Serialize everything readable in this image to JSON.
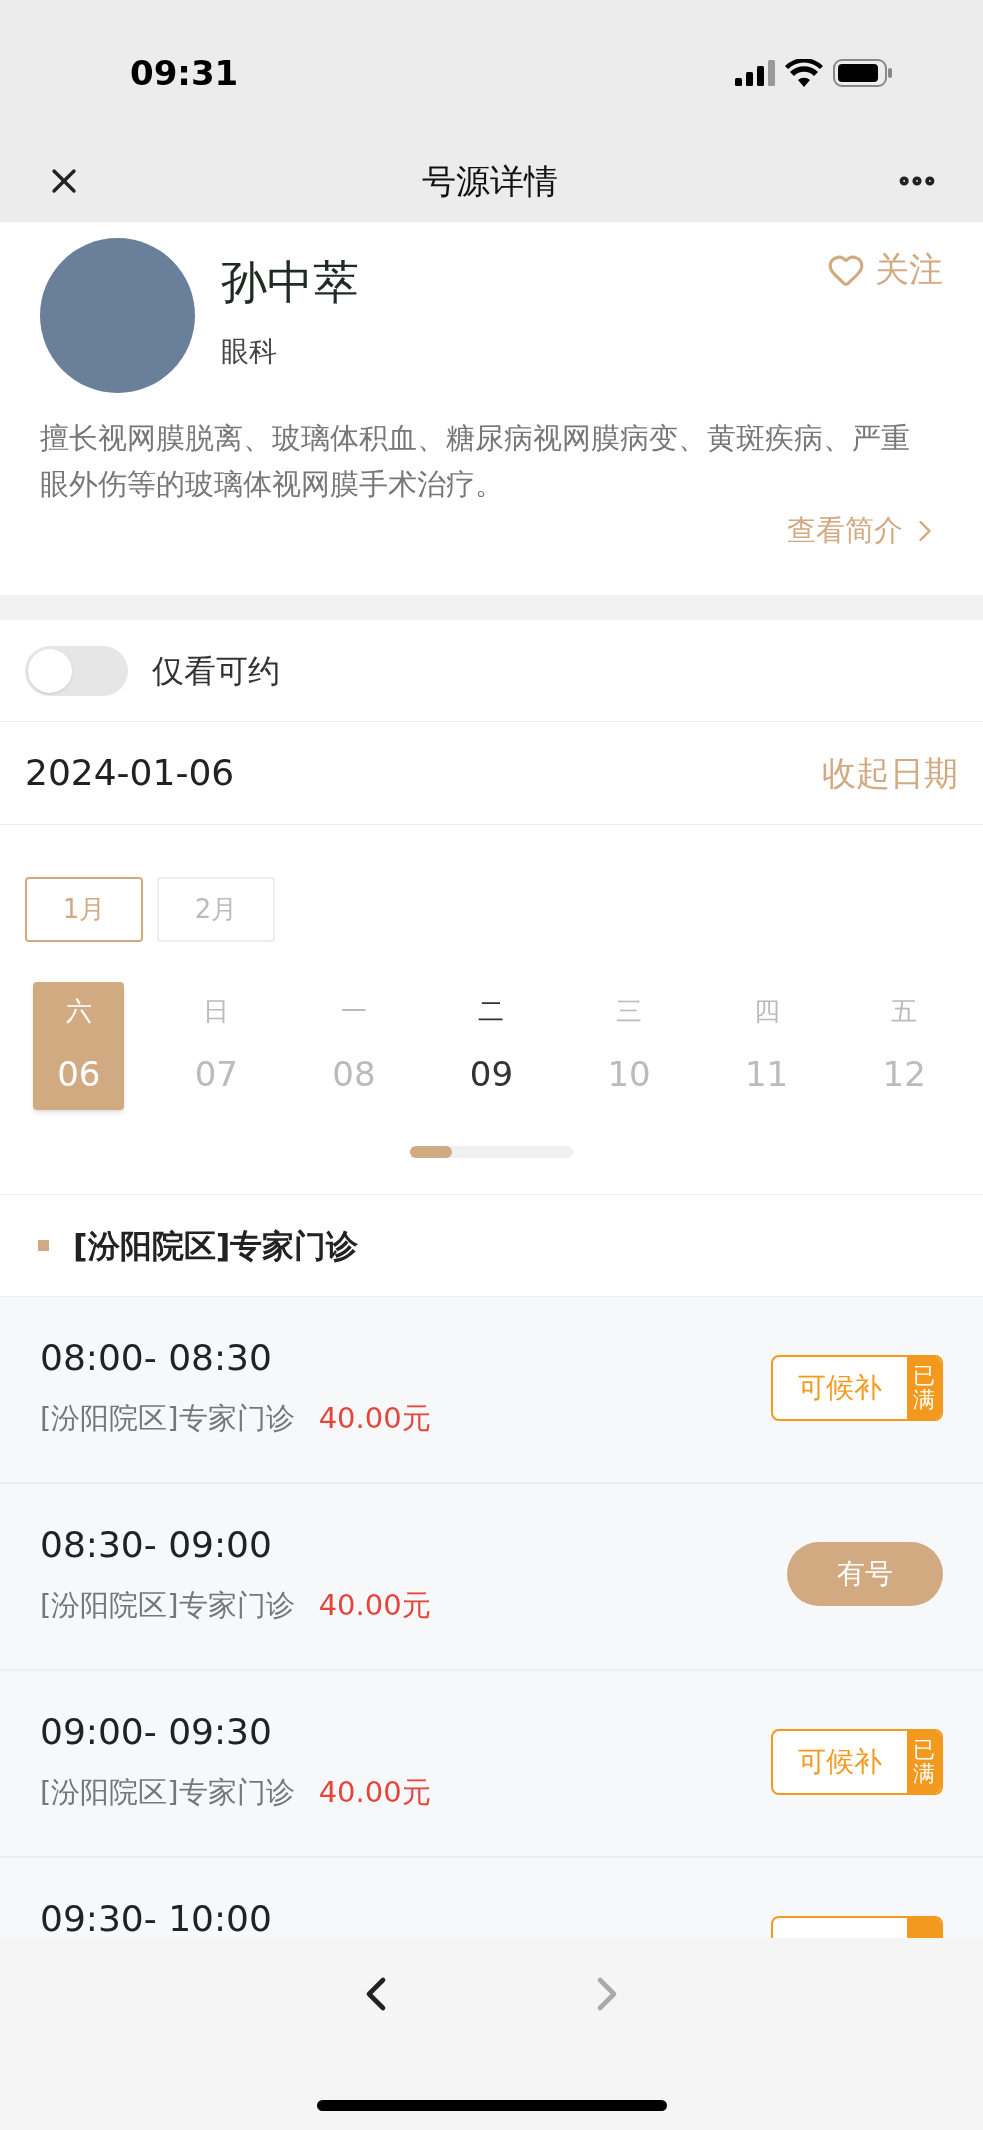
{
  "status_bar": {
    "time": "09:31"
  },
  "header": {
    "title": "号源详情"
  },
  "doctor": {
    "name": "孙中萃",
    "department": "眼科",
    "follow_label": "关注",
    "followed": false,
    "description": "擅长视网膜脱离、玻璃体积血、糖尿病视网膜病变、黄斑疾病、严重眼外伤等的玻璃体视网膜手术治疗。",
    "profile_link": "查看简介"
  },
  "filter": {
    "label": "仅看可约",
    "on": false
  },
  "date_bar": {
    "date": "2024-01-06",
    "collapse_label": "收起日期"
  },
  "months": [
    {
      "label": "1月",
      "selected": true
    },
    {
      "label": "2月",
      "selected": false
    }
  ],
  "days": [
    {
      "weekday": "六",
      "day": "06",
      "selected": true,
      "available": true
    },
    {
      "weekday": "日",
      "day": "07",
      "selected": false,
      "available": false
    },
    {
      "weekday": "一",
      "day": "08",
      "selected": false,
      "available": false
    },
    {
      "weekday": "二",
      "day": "09",
      "selected": false,
      "available": true
    },
    {
      "weekday": "三",
      "day": "10",
      "selected": false,
      "available": false
    },
    {
      "weekday": "四",
      "day": "11",
      "selected": false,
      "available": false
    },
    {
      "weekday": "五",
      "day": "12",
      "selected": false,
      "available": false
    }
  ],
  "section": {
    "title": "[汾阳院区]专家门诊"
  },
  "slots": [
    {
      "time": "08:00- 08:30",
      "location": "[汾阳院区]专家门诊",
      "price": "40.00元",
      "status": {
        "kind": "waitlist",
        "label": "可候补",
        "tag": "已满"
      }
    },
    {
      "time": "08:30- 09:00",
      "location": "[汾阳院区]专家门诊",
      "price": "40.00元",
      "status": {
        "kind": "available",
        "label": "有号"
      }
    },
    {
      "time": "09:00- 09:30",
      "location": "[汾阳院区]专家门诊",
      "price": "40.00元",
      "status": {
        "kind": "waitlist",
        "label": "可候补",
        "tag": "已满"
      }
    },
    {
      "time": "09:30- 10:00",
      "status": {
        "kind": "waitlist"
      }
    }
  ]
}
